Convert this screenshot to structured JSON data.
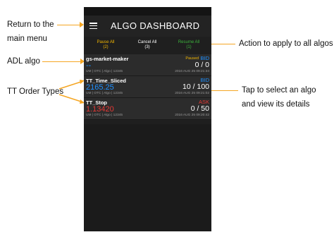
{
  "callouts": {
    "return_menu": [
      "Return to the",
      "main menu"
    ],
    "adl_algo": "ADL algo",
    "tt_order_types": "TT Order Types",
    "action_all": "Action to apply to all algos",
    "tap_select": [
      "Tap to select an algo",
      "and view its details"
    ]
  },
  "colors": {
    "arrow": "#f5a623",
    "pause": "#f0b400",
    "resume": "#3cb43c",
    "bid": "#1e90ff",
    "ask": "#e53935"
  },
  "appbar": {
    "title": "ALGO DASHBOARD",
    "menu_icon": "hamburger-menu-icon"
  },
  "actions": {
    "pause": {
      "label": "Pause All",
      "count": "(2)"
    },
    "cancel": {
      "label": "Cancel All",
      "count": "(3)"
    },
    "resume": {
      "label": "Resume All",
      "count": "(1)"
    }
  },
  "algos": [
    {
      "name": "gs-market-maker",
      "status": "Paused",
      "side": "BID",
      "price": "--",
      "qty": "0 / 0",
      "meta": "UM | OTC | Algo | 12345",
      "time": "2016 AUG 25 09:21:34"
    },
    {
      "name": "TT_Time_Sliced",
      "status": "",
      "side": "BID",
      "price": "2165.25",
      "qty": "10 / 100",
      "meta": "UM | OTC | Algo | 12345",
      "time": "2016 AUG 25 09:21:02"
    },
    {
      "name": "TT_Stop",
      "status": "",
      "side": "ASK",
      "price": "1.13420",
      "qty": "0 / 50",
      "meta": "UM | OTC | Algo | 12345",
      "time": "2016 AUG 25 09:20:42"
    }
  ]
}
